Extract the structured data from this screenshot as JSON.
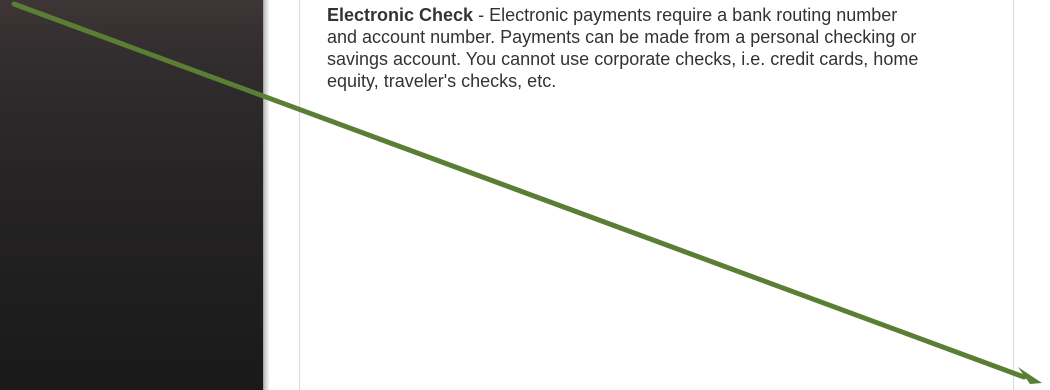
{
  "sidebar": {
    "background_color": "#262424"
  },
  "payment_method": {
    "name": "Electronic Check",
    "separator": " - ",
    "description": "Electronic payments require a bank routing number and account number. Payments can be made from a personal checking or savings account. You cannot use corporate checks, i.e. credit cards, home equity, traveler's checks, etc."
  },
  "annotation": {
    "icon": "arrow-icon",
    "color": "#5a7f34"
  }
}
